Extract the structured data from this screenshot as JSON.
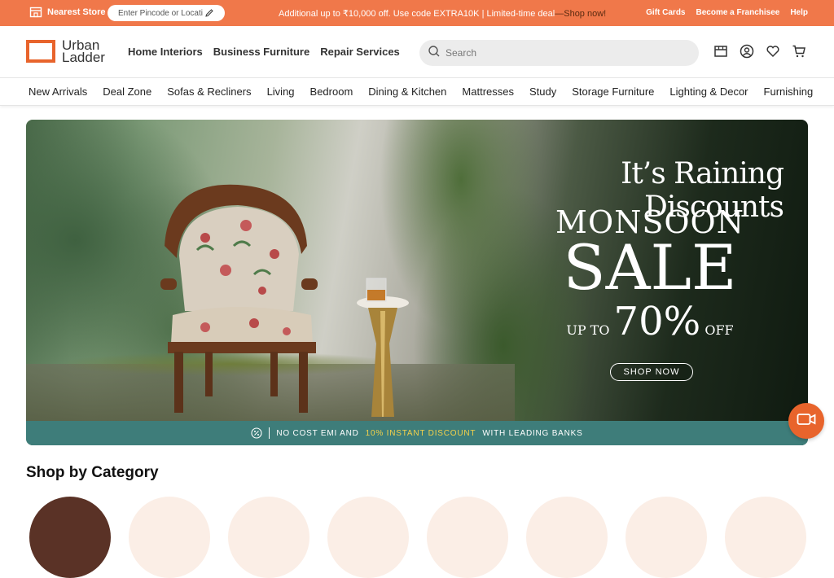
{
  "topbar": {
    "nearest_store_label": "Nearest Store -",
    "pincode_placeholder": "Enter Pincode or Location",
    "promo_text": "Additional up to ₹10,000 off. Use code EXTRA10K | Limited-time deal",
    "promo_link": "—Shop now!",
    "links": [
      "Gift Cards",
      "Become a Franchisee",
      "Help"
    ]
  },
  "header": {
    "logo_line1": "Urban",
    "logo_line2": "Ladder",
    "nav": [
      "Home Interiors",
      "Business Furniture",
      "Repair Services"
    ],
    "search_placeholder": "Search",
    "icons": [
      "store-icon",
      "account-icon",
      "wishlist-icon",
      "cart-icon"
    ]
  },
  "category_nav": [
    "New Arrivals",
    "Deal Zone",
    "Sofas & Recliners",
    "Living",
    "Bedroom",
    "Dining & Kitchen",
    "Mattresses",
    "Study",
    "Storage Furniture",
    "Lighting & Decor",
    "Furnishing"
  ],
  "banner": {
    "headline": "It’s Raining Discounts",
    "monsoon": "MONSOON",
    "sale": "SALE",
    "upto": "UP TO",
    "percent": "70%",
    "off": "OFF",
    "cta": "SHOP NOW",
    "emi_part1": "NO COST EMI AND",
    "emi_highlight": "10% INSTANT DISCOUNT",
    "emi_part2": "WITH LEADING BANKS"
  },
  "shop_by_category": {
    "title": "Shop by Category"
  },
  "colors": {
    "brand_orange": "#e8642c",
    "topbar": "#f0784a",
    "emi_bar": "#3e7d7a",
    "emi_highlight": "#f4d14a"
  }
}
